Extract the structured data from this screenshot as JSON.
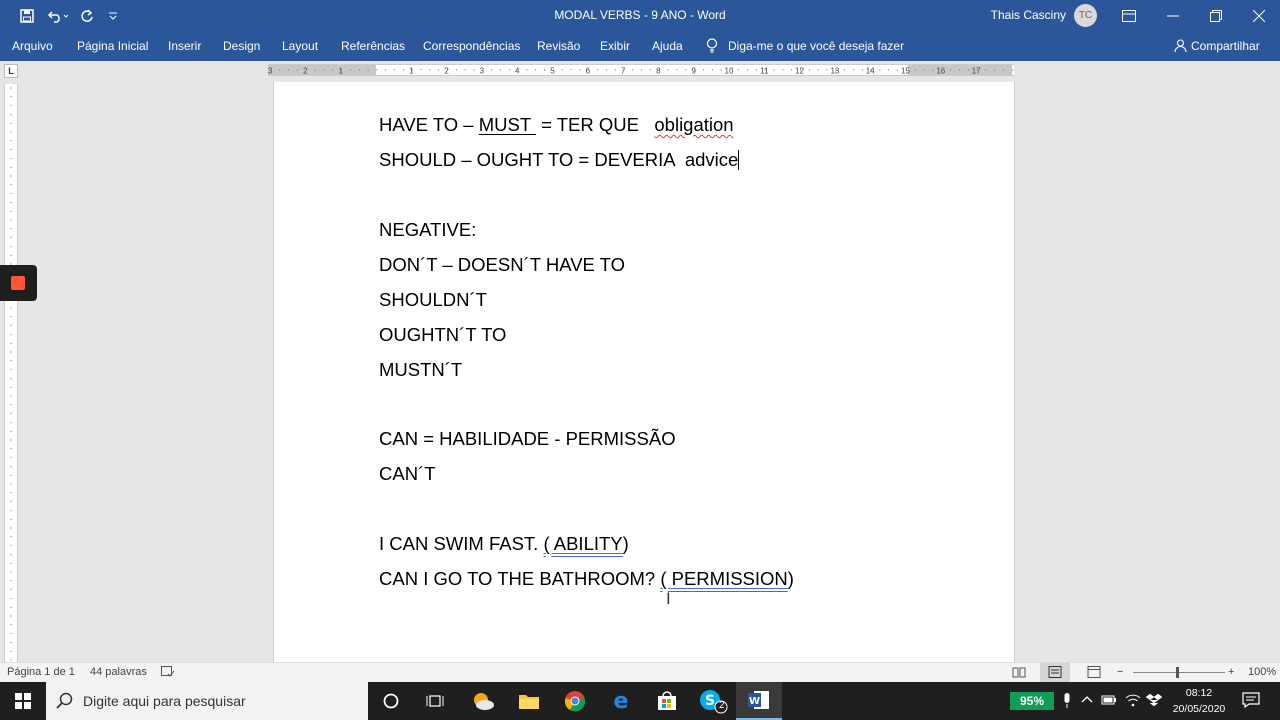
{
  "window": {
    "title": "MODAL VERBS - 9 ANO  -  Word",
    "user_name": "Thais Casciny",
    "user_initials": "TC"
  },
  "ribbon": {
    "tabs": [
      "Arquivo",
      "Página Inicial",
      "Inserir",
      "Design",
      "Layout",
      "Referências",
      "Correspondências",
      "Revisão",
      "Exibir",
      "Ajuda"
    ],
    "tell_me": "Diga-me o que você deseja fazer",
    "share": "Compartilhar"
  },
  "ruler": {
    "tab_selector": "L",
    "numbers": [
      "3",
      "2",
      "1",
      "1",
      "2",
      "3",
      "4",
      "5",
      "6",
      "7",
      "8",
      "9",
      "10",
      "11",
      "12",
      "13",
      "14",
      "15",
      "16",
      "17"
    ]
  },
  "document": {
    "lines": {
      "l1_a": "HAVE TO – ",
      "l1_must": "MUST ",
      "l1_b": " = TER QUE   ",
      "l1_obligation": "obligation",
      "l2_a": "SHOULD – OUGHT TO = DEVERIA  advice",
      "l3": "NEGATIVE:",
      "l4": "DON´T – DOESN´T HAVE TO",
      "l5": "SHOULDN´T",
      "l6": "OUGHTN´T TO",
      "l7": "MUSTN´T",
      "l8": "CAN = HABILIDADE - PERMISSÃO",
      "l9": "CAN´T",
      "l10_a": "I CAN SWIM FAST. ",
      "l10_b": "( ABILITY",
      "l10_c": ")",
      "l11_a": "CAN I GO TO THE BATHROOM? ",
      "l11_b": "( PERMISSION",
      "l11_c": ")"
    }
  },
  "statusbar": {
    "page": "Página 1 de 1",
    "words": "44 palavras",
    "zoom": "100%"
  },
  "taskbar": {
    "search_placeholder": "Digite aqui para pesquisar",
    "battery": "95%",
    "time": "08:12",
    "date": "20/05/2020",
    "skype_badge": "2"
  },
  "colors": {
    "word_blue": "#2b579a",
    "spell_error": "#e23b2e",
    "battery_green": "#0f9d58"
  }
}
